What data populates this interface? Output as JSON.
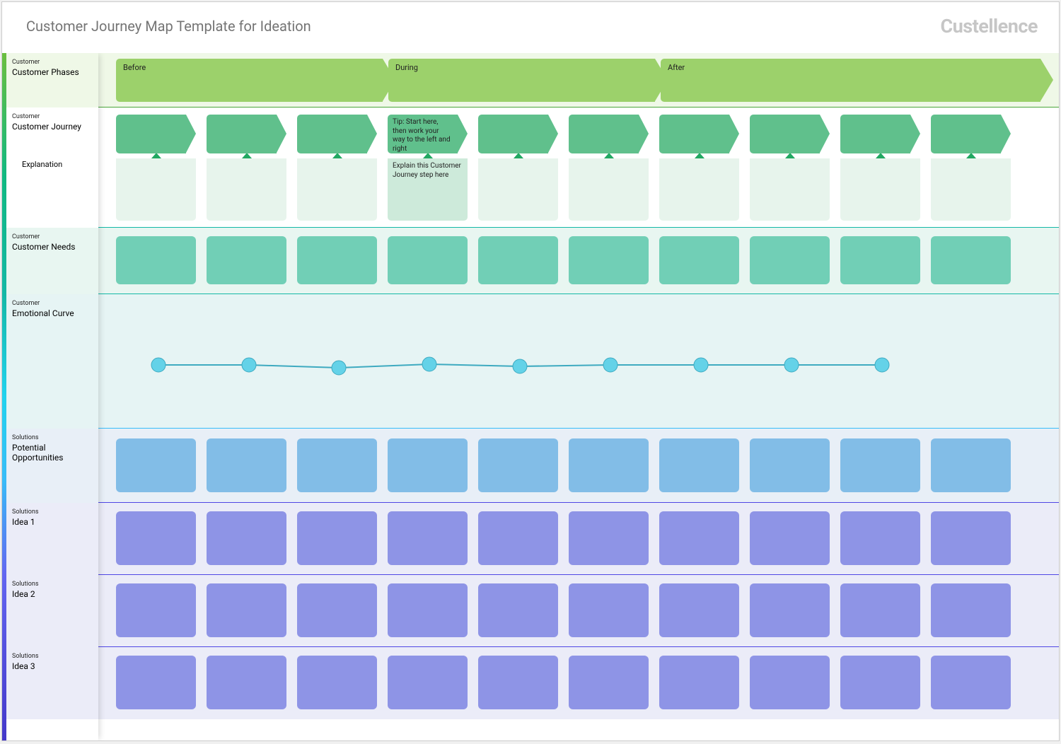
{
  "header": {
    "title": "Customer Journey Map Template for Ideation",
    "brand": "Custellence"
  },
  "category": {
    "customer": "Customer",
    "solutions": "Solutions"
  },
  "lanes": {
    "phases": "Customer Phases",
    "journey": "Customer Journey",
    "explanation": "Explanation",
    "needs": "Customer Needs",
    "emotional": "Emotional Curve",
    "opportunities": "Potential Opportunities",
    "idea1": "Idea 1",
    "idea2": "Idea 2",
    "idea3": "Idea 3"
  },
  "phases": [
    {
      "label": "Before"
    },
    {
      "label": "During"
    },
    {
      "label": "After"
    }
  ],
  "journey": {
    "tip": "Tip: Start here, then work your way to the left and right",
    "explain": "Explain this Customer Journey step here",
    "active_index": 3
  }
}
